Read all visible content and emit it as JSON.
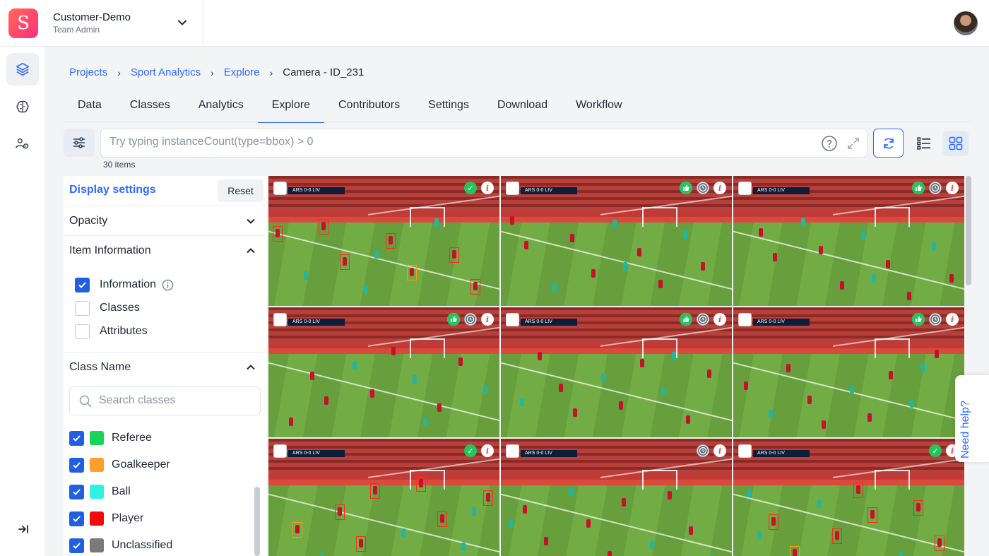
{
  "workspace": {
    "name": "Customer-Demo",
    "role": "Team Admin",
    "logo_letter": "S"
  },
  "breadcrumb": {
    "items": [
      "Projects",
      "Sport Analytics",
      "Explore"
    ],
    "current": "Camera - ID_231",
    "separator": "›"
  },
  "tabs": [
    {
      "label": "Data"
    },
    {
      "label": "Classes"
    },
    {
      "label": "Analytics"
    },
    {
      "label": "Explore",
      "active": true
    },
    {
      "label": "Contributors"
    },
    {
      "label": "Settings"
    },
    {
      "label": "Download"
    },
    {
      "label": "Workflow"
    }
  ],
  "search": {
    "placeholder": "Try typing instanceCount(type=bbox) > 0",
    "value": ""
  },
  "items_count": "30 items",
  "display_settings": {
    "title": "Display settings",
    "reset_label": "Reset",
    "opacity_label": "Opacity",
    "item_information": {
      "label": "Item Information",
      "options": [
        {
          "label": "Information",
          "checked": true
        },
        {
          "label": "Classes",
          "checked": false
        },
        {
          "label": "Attributes",
          "checked": false
        }
      ]
    },
    "class_name": {
      "label": "Class Name",
      "search_placeholder": "Search classes",
      "classes": [
        {
          "label": "Referee",
          "color": "#16d65a",
          "checked": true
        },
        {
          "label": "Goalkeeper",
          "color": "#ff9f2e",
          "checked": true
        },
        {
          "label": "Ball",
          "color": "#2ef2e0",
          "checked": true
        },
        {
          "label": "Player",
          "color": "#f00a0a",
          "checked": true
        },
        {
          "label": "Unclassified",
          "color": "#7a7a7a",
          "checked": true
        }
      ]
    }
  },
  "gallery": {
    "scoreboard": "ARS 0-0 LIV",
    "tiles": [
      {
        "status": [
          "check-icon",
          "info-icon"
        ],
        "annotated": true
      },
      {
        "status": [
          "like-icon",
          "clock-icon",
          "info-icon"
        ],
        "annotated": false
      },
      {
        "status": [
          "like-icon",
          "clock-icon",
          "info-icon"
        ],
        "annotated": false
      },
      {
        "status": [
          "like-icon",
          "clock-icon",
          "info-icon"
        ],
        "annotated": false
      },
      {
        "status": [
          "like-icon",
          "clock-icon",
          "info-icon"
        ],
        "annotated": false
      },
      {
        "status": [
          "like-icon",
          "clock-icon",
          "info-icon"
        ],
        "annotated": false
      },
      {
        "status": [
          "check-icon",
          "info-icon"
        ],
        "annotated": true
      },
      {
        "status": [
          "clock-icon",
          "info-icon"
        ],
        "annotated": false
      },
      {
        "status": [
          "check-icon",
          "info-icon"
        ],
        "annotated": true
      }
    ]
  },
  "help_label": "Need help?",
  "colors": {
    "accent": "#2f6bff",
    "checkbox": "#1f5fe0",
    "success": "#22c55e"
  }
}
